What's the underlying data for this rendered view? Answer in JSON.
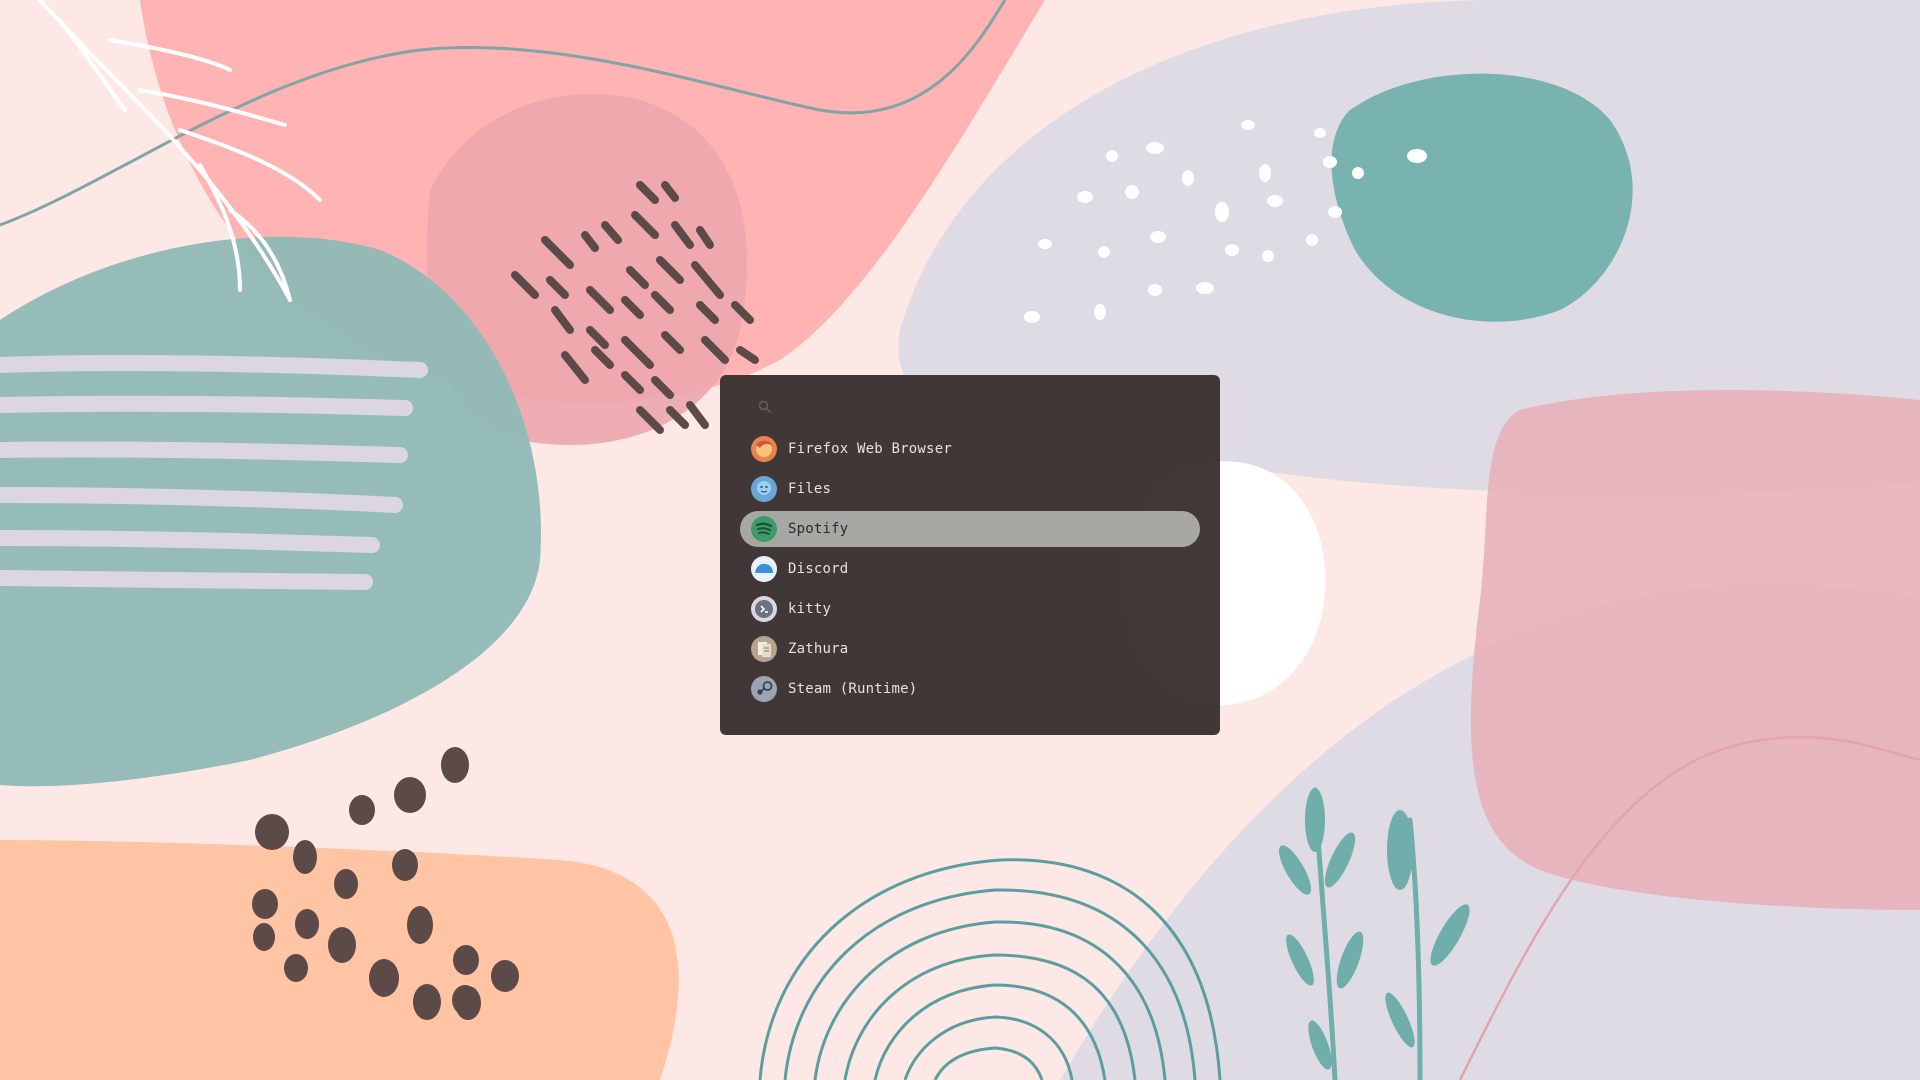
{
  "launcher": {
    "search": {
      "value": "",
      "placeholder": ""
    },
    "selected_index": 2,
    "apps": [
      {
        "label": "Firefox Web Browser",
        "icon": "firefox-icon",
        "color": "#e8834e"
      },
      {
        "label": "Files",
        "icon": "files-icon",
        "color": "#6aa6d6"
      },
      {
        "label": "Spotify",
        "icon": "spotify-icon",
        "color": "#3f9a6a"
      },
      {
        "label": "Discord",
        "icon": "discord-icon",
        "color": "#3b8fd9"
      },
      {
        "label": "kitty",
        "icon": "kitty-icon",
        "color": "#6b7280"
      },
      {
        "label": "Zathura",
        "icon": "zathura-icon",
        "color": "#b8a58f"
      },
      {
        "label": "Steam (Runtime)",
        "icon": "steam-icon",
        "color": "#9aa5b4"
      }
    ]
  },
  "theme": {
    "panel_bg": "#3a3030",
    "highlight": "#a7a7a4",
    "wallpaper_pink": "#ffb3b3",
    "wallpaper_teal": "#78b3b0",
    "wallpaper_lavender": "#dcdae5",
    "wallpaper_peach": "#ffc4a4",
    "wallpaper_dots": "#5b4a48"
  }
}
